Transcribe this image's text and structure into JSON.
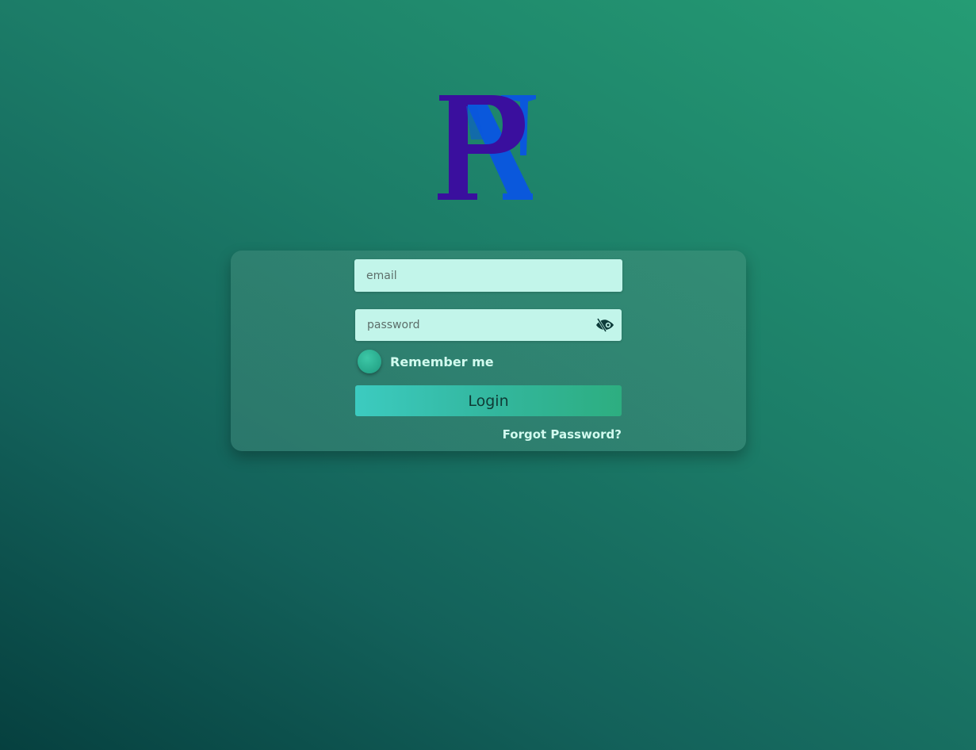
{
  "logo": {
    "alt": "RP logo"
  },
  "login_form": {
    "email": {
      "value": "",
      "placeholder": "email"
    },
    "password": {
      "value": "",
      "placeholder": "password",
      "toggle_icon": "eye-slash-icon"
    },
    "remember_me": {
      "label": "Remember me",
      "checked": false
    },
    "login_button": {
      "label": "Login"
    },
    "forgot_password": {
      "label": "Forgot Password?"
    }
  },
  "colors": {
    "background_dark": "#06403f",
    "background_light": "#259c74",
    "field_bg": "#c2f5ea",
    "logo_purple": "#3a0f9e",
    "logo_blue": "#0a58dc",
    "button_start": "#3ccbc0",
    "button_end": "#2dae80"
  }
}
